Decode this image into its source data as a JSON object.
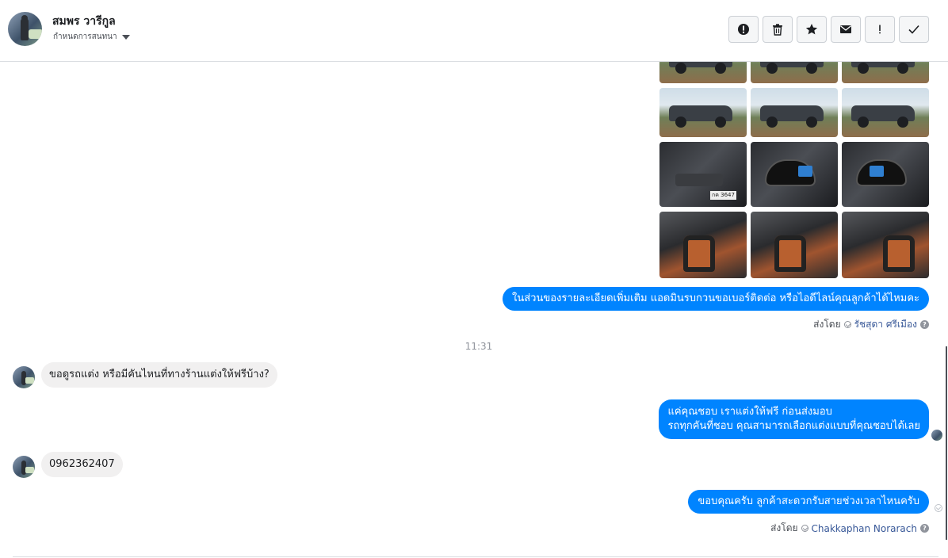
{
  "header": {
    "contact_name": "สมพร วารีกูล",
    "conversation_settings": "กำหนดการสนทนา",
    "actions": [
      {
        "name": "report",
        "icon": "alert-circle-icon",
        "glyph": "!"
      },
      {
        "name": "delete",
        "icon": "trash-icon"
      },
      {
        "name": "star",
        "icon": "star-icon"
      },
      {
        "name": "mark-unread",
        "icon": "envelope-icon"
      },
      {
        "name": "important",
        "icon": "exclamation-icon",
        "glyph": "!"
      },
      {
        "name": "done",
        "icon": "check-icon"
      }
    ]
  },
  "photos": {
    "rows": [
      [
        "exterior",
        "exterior",
        "exterior"
      ],
      [
        "exterior",
        "exterior",
        "exterior"
      ],
      [
        "interior",
        "interior",
        "interior"
      ],
      [
        "seats",
        "seats",
        "seats"
      ]
    ],
    "plate_text": "กค 3647"
  },
  "messages": [
    {
      "side": "out",
      "text": "ในส่วนของรายละเอียดเพิ่มเติม แอดมินรบกวนขอเบอร์ติดต่อ หรือไอดีไลน์คุณลูกค้าได้ไหมคะ"
    },
    {
      "side": "in",
      "text": "ขอดูรถแต่ง หรือมีคันไหนที่ทางร้านแต่งให้ฟรีบ้าง?"
    },
    {
      "side": "out",
      "line1": "แค่คุณชอบ เราแต่งให้ฟรี ก่อนส่งมอบ",
      "line2": "รถทุกคันที่ชอบ คุณสามารถเลือกแต่งแบบที่คุณชอบได้เลย"
    },
    {
      "side": "in",
      "text": "0962362407"
    },
    {
      "side": "out",
      "text": "ขอบคุณครับ ลูกค้าสะดวกรับสายช่วงเวลาไหนครับ"
    }
  ],
  "sent_by_1": {
    "label": "ส่งโดย",
    "who": "รัชสุดา ศรีเมือง"
  },
  "sent_by_2": {
    "label": "ส่งโดย",
    "who": "Chakkaphan Norarach"
  },
  "timestamp": "11:31",
  "colors": {
    "outgoing": "#0084ff",
    "incoming": "#f1f0f0",
    "link": "#385898"
  }
}
